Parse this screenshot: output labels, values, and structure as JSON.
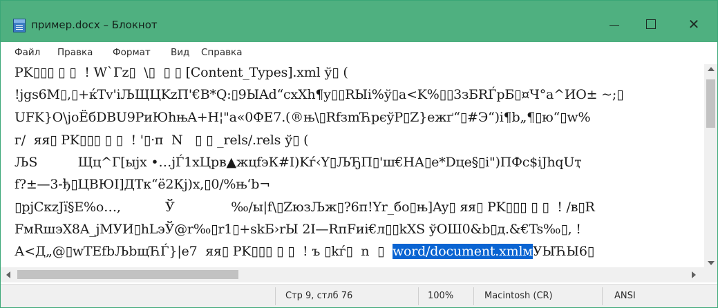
{
  "window": {
    "title": "пример.docx – Блокнот",
    "accent_color": "#4fb080",
    "controls": {
      "minimize_icon": "minimize-icon",
      "maximize_icon": "maximize-icon",
      "close_icon": "close-icon",
      "close_glyph": "✕"
    }
  },
  "menu": {
    "items": [
      {
        "label": "Файл"
      },
      {
        "label": "Правка"
      },
      {
        "label": "Формат"
      },
      {
        "label": "Вид"
      },
      {
        "label": "Справка"
      }
    ]
  },
  "editor": {
    "lines": [
      "PK▯▯▯ ▯ ▯  ! W`Гz▯  \\▯  ▯ ▯ [Content_Types].xml ў▯ (",
      "!jgs6M▯,▯+ќTv'iЉЩЦKzП'€В*Q:▯9ЫAd“cxXh¶y▯▯RЫi%ў▯a<K%▯▯3зБRЃрБ▯¤Ч°a^ИО± ~;▯",
      "UFK}O\\joЁбDBU9РиЮhњA+H¦\"a«0ФЕ7.(®њ\\▯RfзmЋрєўP▯Z}ежґ“▯#Э“)i¶b„¶▯ю“▯w%",
      "г/  яя▯ PK▯▯▯ ▯ ▯  ! '▯·п  N   ▯ ▯ _rels/.rels ў▯ (",
      "ЉS          Щц^Г[ыјх •…jЃ1xЦрв▲жцfэК#I)Kѓ‹Y▯ЉЂП▯'ш€НА▯e*Dце§▯i\")ПФc$iЈhqUҭ",
      "f?±—3-ђ▯ЦВЮI]ДТк“ё2Кj)x,▯0/%њ‘b¬",
      "▯pjCкzЈї§E%о…,           Ў              ‰/ы|f\\▯ZюзЉж▯?6п!Yr_бо▯њ]Ay▯ яя▯ PK▯▯▯ ▯ ▯  ! /в▯R",
      "FмRшэX8A_jМУИ▯hLэЎ@r‰▯r1▯+skБ›rЫ 2I—RпFиi€л▯▯kXS ўОШ0&b▯д.&€Ts‰▯, !",
      "А<Д„@▯wTEfbЉbщЋЃ}|e7  яя▯ PK▯▯▯ ▯ ▯  ! ъ ▯kѓ▯  n  ▯  "
    ],
    "selected_text": "word/document.xmlм",
    "after_selection": "УЫЋЫ6▯",
    "selection_color": "#0a64d2"
  },
  "scrollbars": {
    "vertical": {
      "up_icon": "scroll-up-arrow-icon",
      "down_icon": "scroll-down-arrow-icon"
    },
    "horizontal": {
      "left_icon": "scroll-left-arrow-icon",
      "right_icon": "scroll-right-arrow-icon"
    }
  },
  "status": {
    "position": "Стр 9, стлб 76",
    "zoom": "100%",
    "line_endings": "Macintosh (CR)",
    "encoding": "ANSI"
  }
}
